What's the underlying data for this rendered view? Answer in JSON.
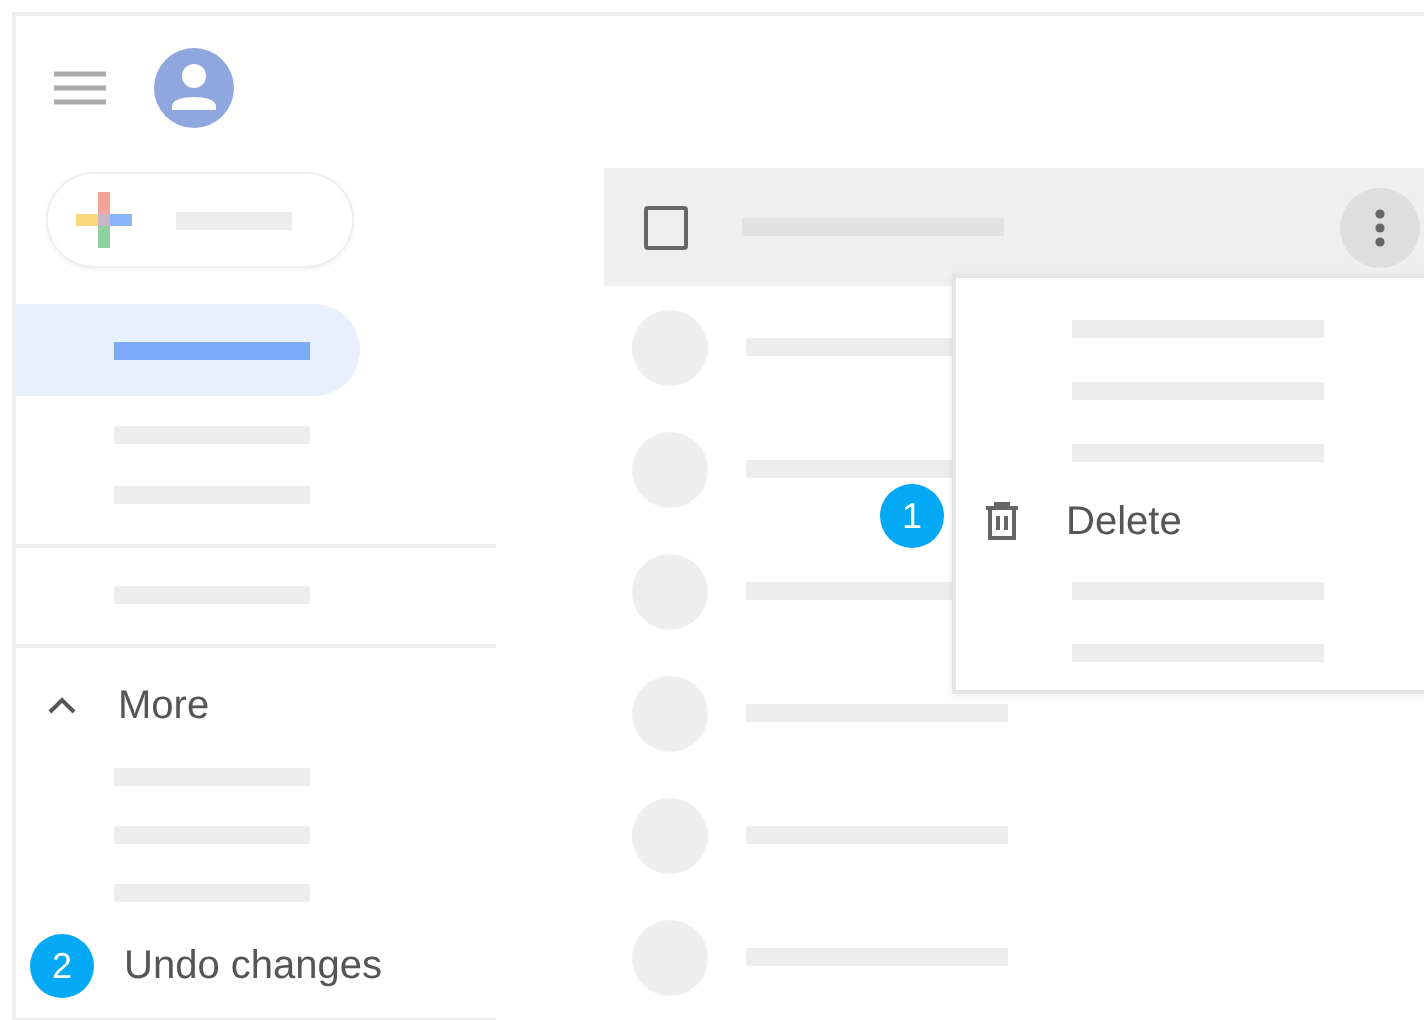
{
  "sidebar": {
    "nav_items": [
      {
        "selected": true
      },
      {
        "selected": false
      },
      {
        "selected": false
      }
    ],
    "section_items": [
      {
        "selected": false
      }
    ],
    "more": {
      "label": "More",
      "expanded": true,
      "items": [
        {
          "selected": false
        },
        {
          "selected": false
        },
        {
          "selected": false
        }
      ]
    },
    "undo": {
      "step": "2",
      "label": "Undo changes"
    }
  },
  "list": {
    "header": {
      "checked": false
    },
    "rows": [
      {
        "selected": false
      },
      {
        "selected": false
      },
      {
        "selected": false
      },
      {
        "selected": false
      },
      {
        "selected": false
      },
      {
        "selected": false
      }
    ]
  },
  "menu": {
    "step": "1",
    "items": [
      {
        "kind": "placeholder"
      },
      {
        "kind": "placeholder"
      },
      {
        "kind": "placeholder"
      },
      {
        "kind": "action",
        "label": "Delete"
      },
      {
        "kind": "placeholder"
      },
      {
        "kind": "placeholder"
      }
    ]
  }
}
